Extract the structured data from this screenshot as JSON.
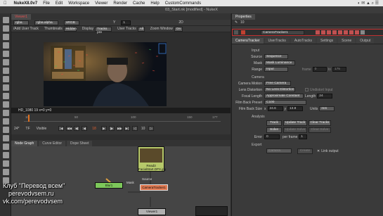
{
  "menubar": {
    "app": "NukeX8.0v7",
    "items": [
      "File",
      "Edit",
      "Workspace",
      "Viewer",
      "Render",
      "Cache",
      "Help",
      "CustomCommands"
    ]
  },
  "window_title": "03_Start.nk [modified] - NukeX",
  "viewer": {
    "tab": "Viewer1",
    "row1": {
      "channels": "rgba",
      "layer": "rgba.alpha",
      "colorspace": "sRGB",
      "y_label": "Y",
      "frame_field": "1",
      "zoom": "2D"
    },
    "row2": {
      "add_user_track": "/Add User Track",
      "thumbnails_label": "Thumbnails",
      "thumbnails_val": "Hidden",
      "display_label": "Display",
      "display_val": "Tracks pre",
      "user_tracks_label": "User Tracks",
      "user_tracks_val": "All",
      "zoom_window_label": "Zoom Window",
      "zoom_window_val": "On"
    },
    "info": "HD_1080 19 x=0 y=0"
  },
  "timeline": {
    "ticks": [
      "10",
      "50",
      "100",
      "150",
      "177"
    ],
    "fps": "24*",
    "tf": "TF",
    "visible": "Visible",
    "frame": "18",
    "step": "10"
  },
  "nodegraph": {
    "tabs": [
      "Node Graph",
      "Curve Editor",
      "Dope Sheet"
    ],
    "nodes": {
      "read": "Read3",
      "read_file": "FacialStart.DPX.jpg",
      "blur": "Blur1",
      "tracker": "CameraTracker1",
      "viewer": "Viewer1",
      "source_label": "Source",
      "mask_label": "Mask"
    }
  },
  "properties": {
    "title": "Properties",
    "node_name": "CameraTracker1",
    "tabs": [
      "CameraTracker",
      "UserTracks",
      "AutoTracks",
      "Settings",
      "Scene",
      "Output"
    ],
    "input_section": "Input",
    "source_label": "Source",
    "source_val": "Sequence",
    "mask_label": "Mask",
    "mask_val": "Mask Luminance",
    "range_label": "Range",
    "range_val": "Input",
    "range_frame_label": "frame",
    "range_from": "0",
    "range_to_label": "to",
    "range_to": "175",
    "camera_section": "Camera",
    "camera_motion_label": "Camera Motion",
    "camera_motion_val": "Free Camera",
    "lens_label": "Lens Distortion",
    "lens_val": "No Lens Distortion",
    "undistort_label": "Undistort Input",
    "focal_label": "Focal Length",
    "focal_val": "Approximate Constant",
    "length_label": "Length",
    "length_val": "24",
    "film_preset_label": "Film Back Preset",
    "film_preset_val": "C100",
    "film_size_label": "Film Back Size",
    "film_x_label": "x",
    "film_x": "24.6",
    "film_y_label": "y",
    "film_y": "13.8",
    "units_label": "Units",
    "units_val": "mm",
    "analysis_section": "Analysis",
    "btn_track": "Track",
    "btn_update_track": "Update Track",
    "btn_clear_tracks": "Clear Tracks",
    "btn_solve": "Solve",
    "btn_update_solve": "Update Solve",
    "btn_clear_solve": "Clear Solve",
    "error_label": "Error",
    "error_val": "0",
    "per_frame_label": "per frame",
    "per_frame_val": "1",
    "export_section": "Export",
    "export_val": "Camera",
    "btn_create": "Create",
    "link_output": "Link output"
  },
  "watermark": {
    "line1": "Клуб \"Перевод всем\"",
    "line2": "perevodvsem.ru",
    "line3": "vk.com/perevodvsem"
  }
}
